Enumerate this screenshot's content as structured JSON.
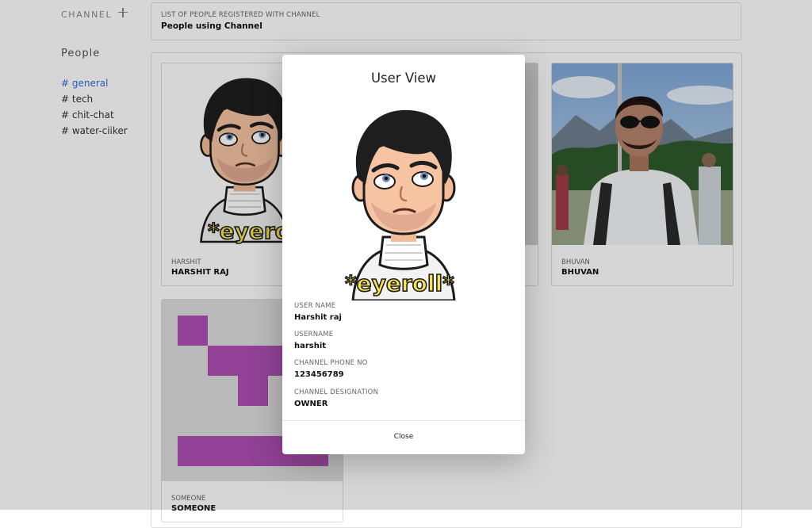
{
  "sidebar": {
    "channel_title": "CHANNEL",
    "people_title": "People",
    "channels": [
      "# general",
      "# tech",
      "# chit-chat",
      "# water-ciiker"
    ],
    "active_color": "#2f6fd6"
  },
  "header": {
    "subtitle": "LIST OF PEOPLE REGISTERED WITH CHANNEL",
    "title": "People using Channel"
  },
  "users": [
    {
      "label": "HARSHIT",
      "name": "HARSHIT RAJ",
      "avatar": "bitmoji-eyeroll"
    },
    {
      "label": "BHUVAN",
      "name": "BHUVAN",
      "avatar": "photo-outdoor"
    },
    {
      "label": "SOMEONE",
      "name": "SOMEONE",
      "avatar": "identicon-purple"
    }
  ],
  "modal": {
    "title": "User View",
    "sticker_text": "*eyeroll*",
    "fields": [
      {
        "label": "USER NAME",
        "value": "Harshit raj"
      },
      {
        "label": "USERNAME",
        "value": "harshit"
      },
      {
        "label": "CHANNEL PHONE NO",
        "value": "123456789"
      },
      {
        "label": "CHANNEL DESIGNATION",
        "value": "OWNER"
      }
    ],
    "close_label": "Close"
  },
  "colors": {
    "accent": "#2f6fd6",
    "identicon": "#ad4fb3",
    "sticker_yellow": "#f6e24a"
  }
}
